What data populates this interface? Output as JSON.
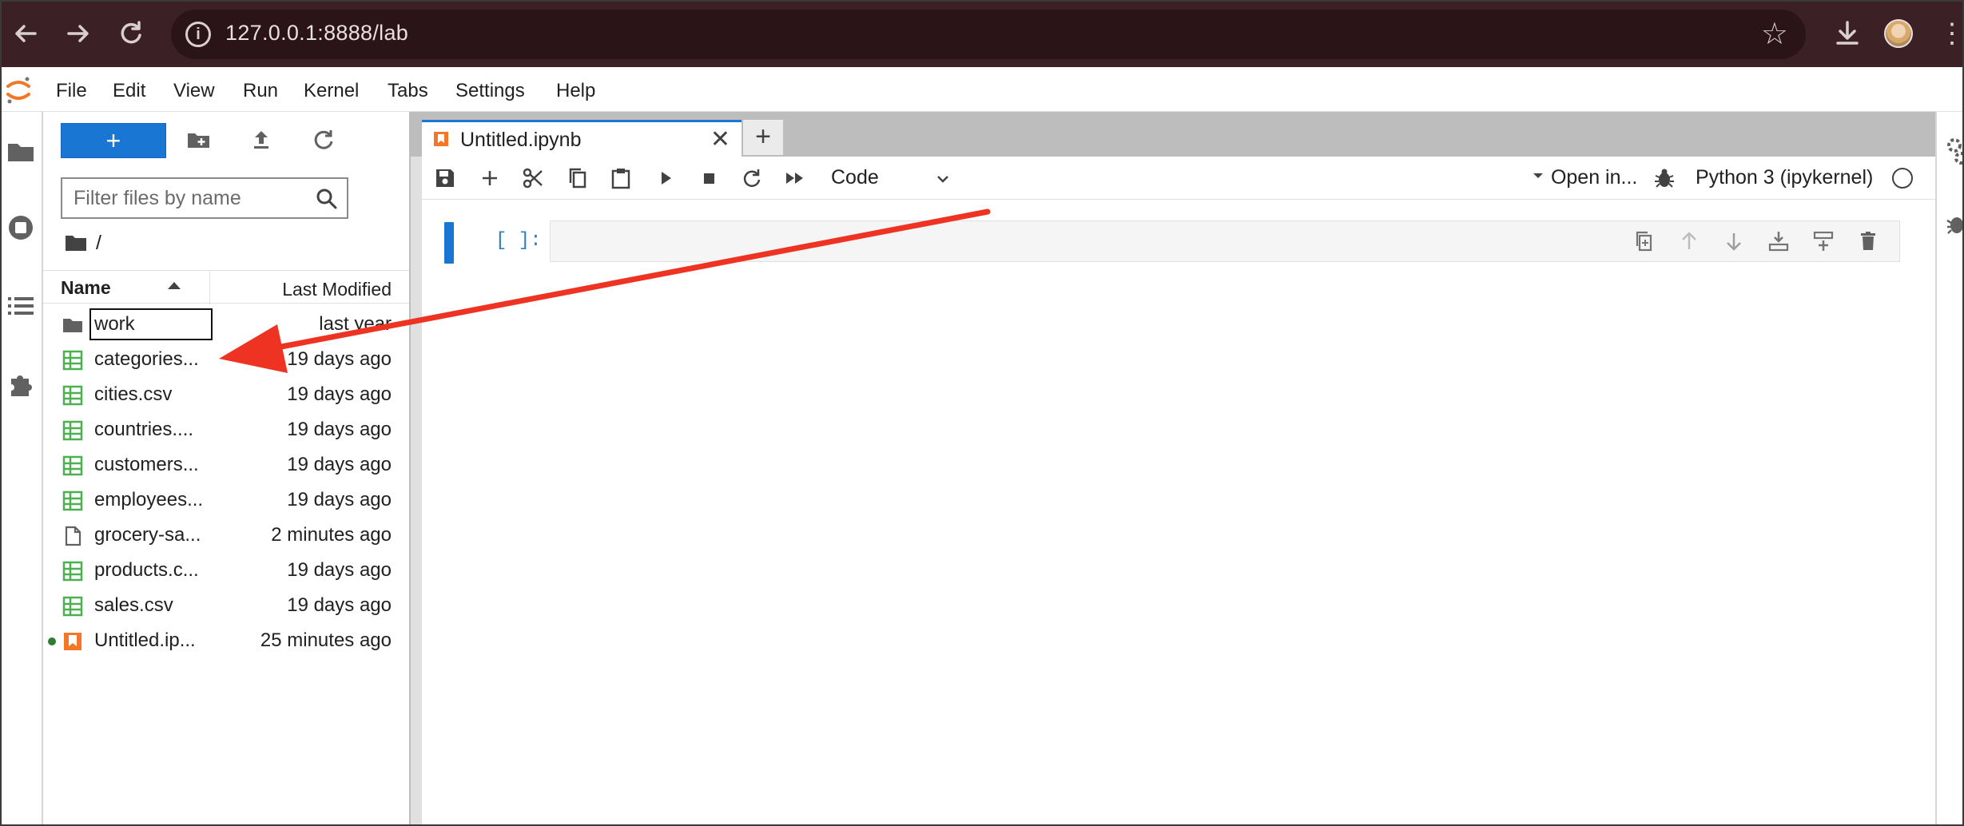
{
  "browser": {
    "url": "127.0.0.1:8888/lab"
  },
  "menu": {
    "items": [
      "File",
      "Edit",
      "View",
      "Run",
      "Kernel",
      "Tabs",
      "Settings",
      "Help"
    ]
  },
  "filebrowser": {
    "new_button_label": "+",
    "filter_placeholder": "Filter files by name",
    "breadcrumb": "/",
    "columns": {
      "name": "Name",
      "modified": "Last Modified"
    },
    "files": [
      {
        "name": "work",
        "modified": "last year",
        "type": "folder",
        "renaming": true
      },
      {
        "name": "categories...",
        "modified": "19 days ago",
        "type": "csv"
      },
      {
        "name": "cities.csv",
        "modified": "19 days ago",
        "type": "csv"
      },
      {
        "name": "countries....",
        "modified": "19 days ago",
        "type": "csv"
      },
      {
        "name": "customers...",
        "modified": "19 days ago",
        "type": "csv"
      },
      {
        "name": "employees...",
        "modified": "19 days ago",
        "type": "csv"
      },
      {
        "name": "grocery-sa...",
        "modified": "2 minutes ago",
        "type": "file"
      },
      {
        "name": "products.c...",
        "modified": "19 days ago",
        "type": "csv"
      },
      {
        "name": "sales.csv",
        "modified": "19 days ago",
        "type": "csv"
      },
      {
        "name": "Untitled.ip...",
        "modified": "25 minutes ago",
        "type": "notebook",
        "running": true
      }
    ]
  },
  "notebook": {
    "tab_label": "Untitled.ipynb",
    "cell_type": "Code",
    "open_in": "Open in...",
    "kernel": "Python 3 (ipykernel)",
    "cell_prompt": "[ ]:"
  },
  "colors": {
    "accent": "#1976d2",
    "csv_icon": "#4caf50",
    "notebook_icon": "#f37726",
    "annotation_arrow": "#ee3322",
    "running_dot": "#2e7d32"
  }
}
